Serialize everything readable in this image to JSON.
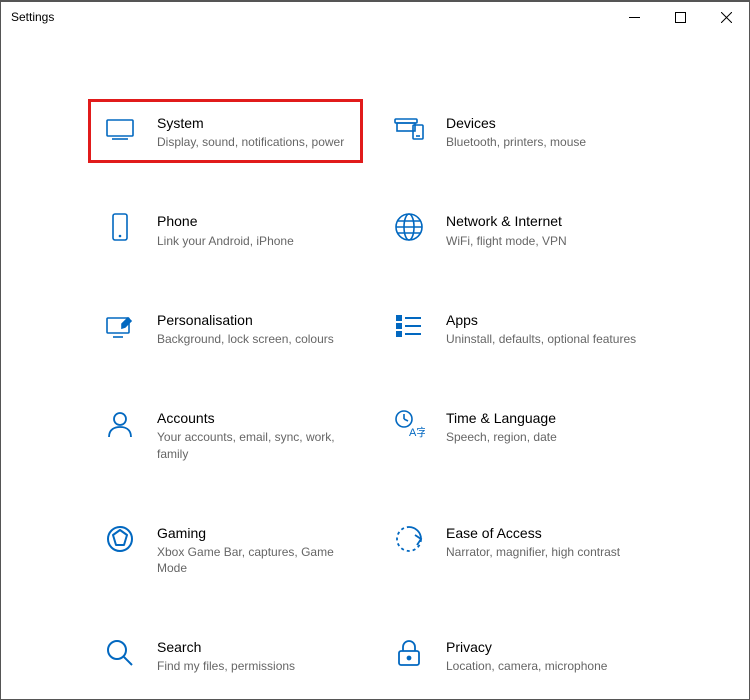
{
  "window": {
    "title": "Settings"
  },
  "items": [
    {
      "title": "System",
      "desc": "Display, sound, notifications, power",
      "highlighted": true
    },
    {
      "title": "Devices",
      "desc": "Bluetooth, printers, mouse",
      "highlighted": false
    },
    {
      "title": "Phone",
      "desc": "Link your Android, iPhone",
      "highlighted": false
    },
    {
      "title": "Network & Internet",
      "desc": "WiFi, flight mode, VPN",
      "highlighted": false
    },
    {
      "title": "Personalisation",
      "desc": "Background, lock screen, colours",
      "highlighted": false
    },
    {
      "title": "Apps",
      "desc": "Uninstall, defaults, optional features",
      "highlighted": false
    },
    {
      "title": "Accounts",
      "desc": "Your accounts, email, sync, work, family",
      "highlighted": false
    },
    {
      "title": "Time & Language",
      "desc": "Speech, region, date",
      "highlighted": false
    },
    {
      "title": "Gaming",
      "desc": "Xbox Game Bar, captures, Game Mode",
      "highlighted": false
    },
    {
      "title": "Ease of Access",
      "desc": "Narrator, magnifier, high contrast",
      "highlighted": false
    },
    {
      "title": "Search",
      "desc": "Find my files, permissions",
      "highlighted": false
    },
    {
      "title": "Privacy",
      "desc": "Location, camera, microphone",
      "highlighted": false
    }
  ]
}
